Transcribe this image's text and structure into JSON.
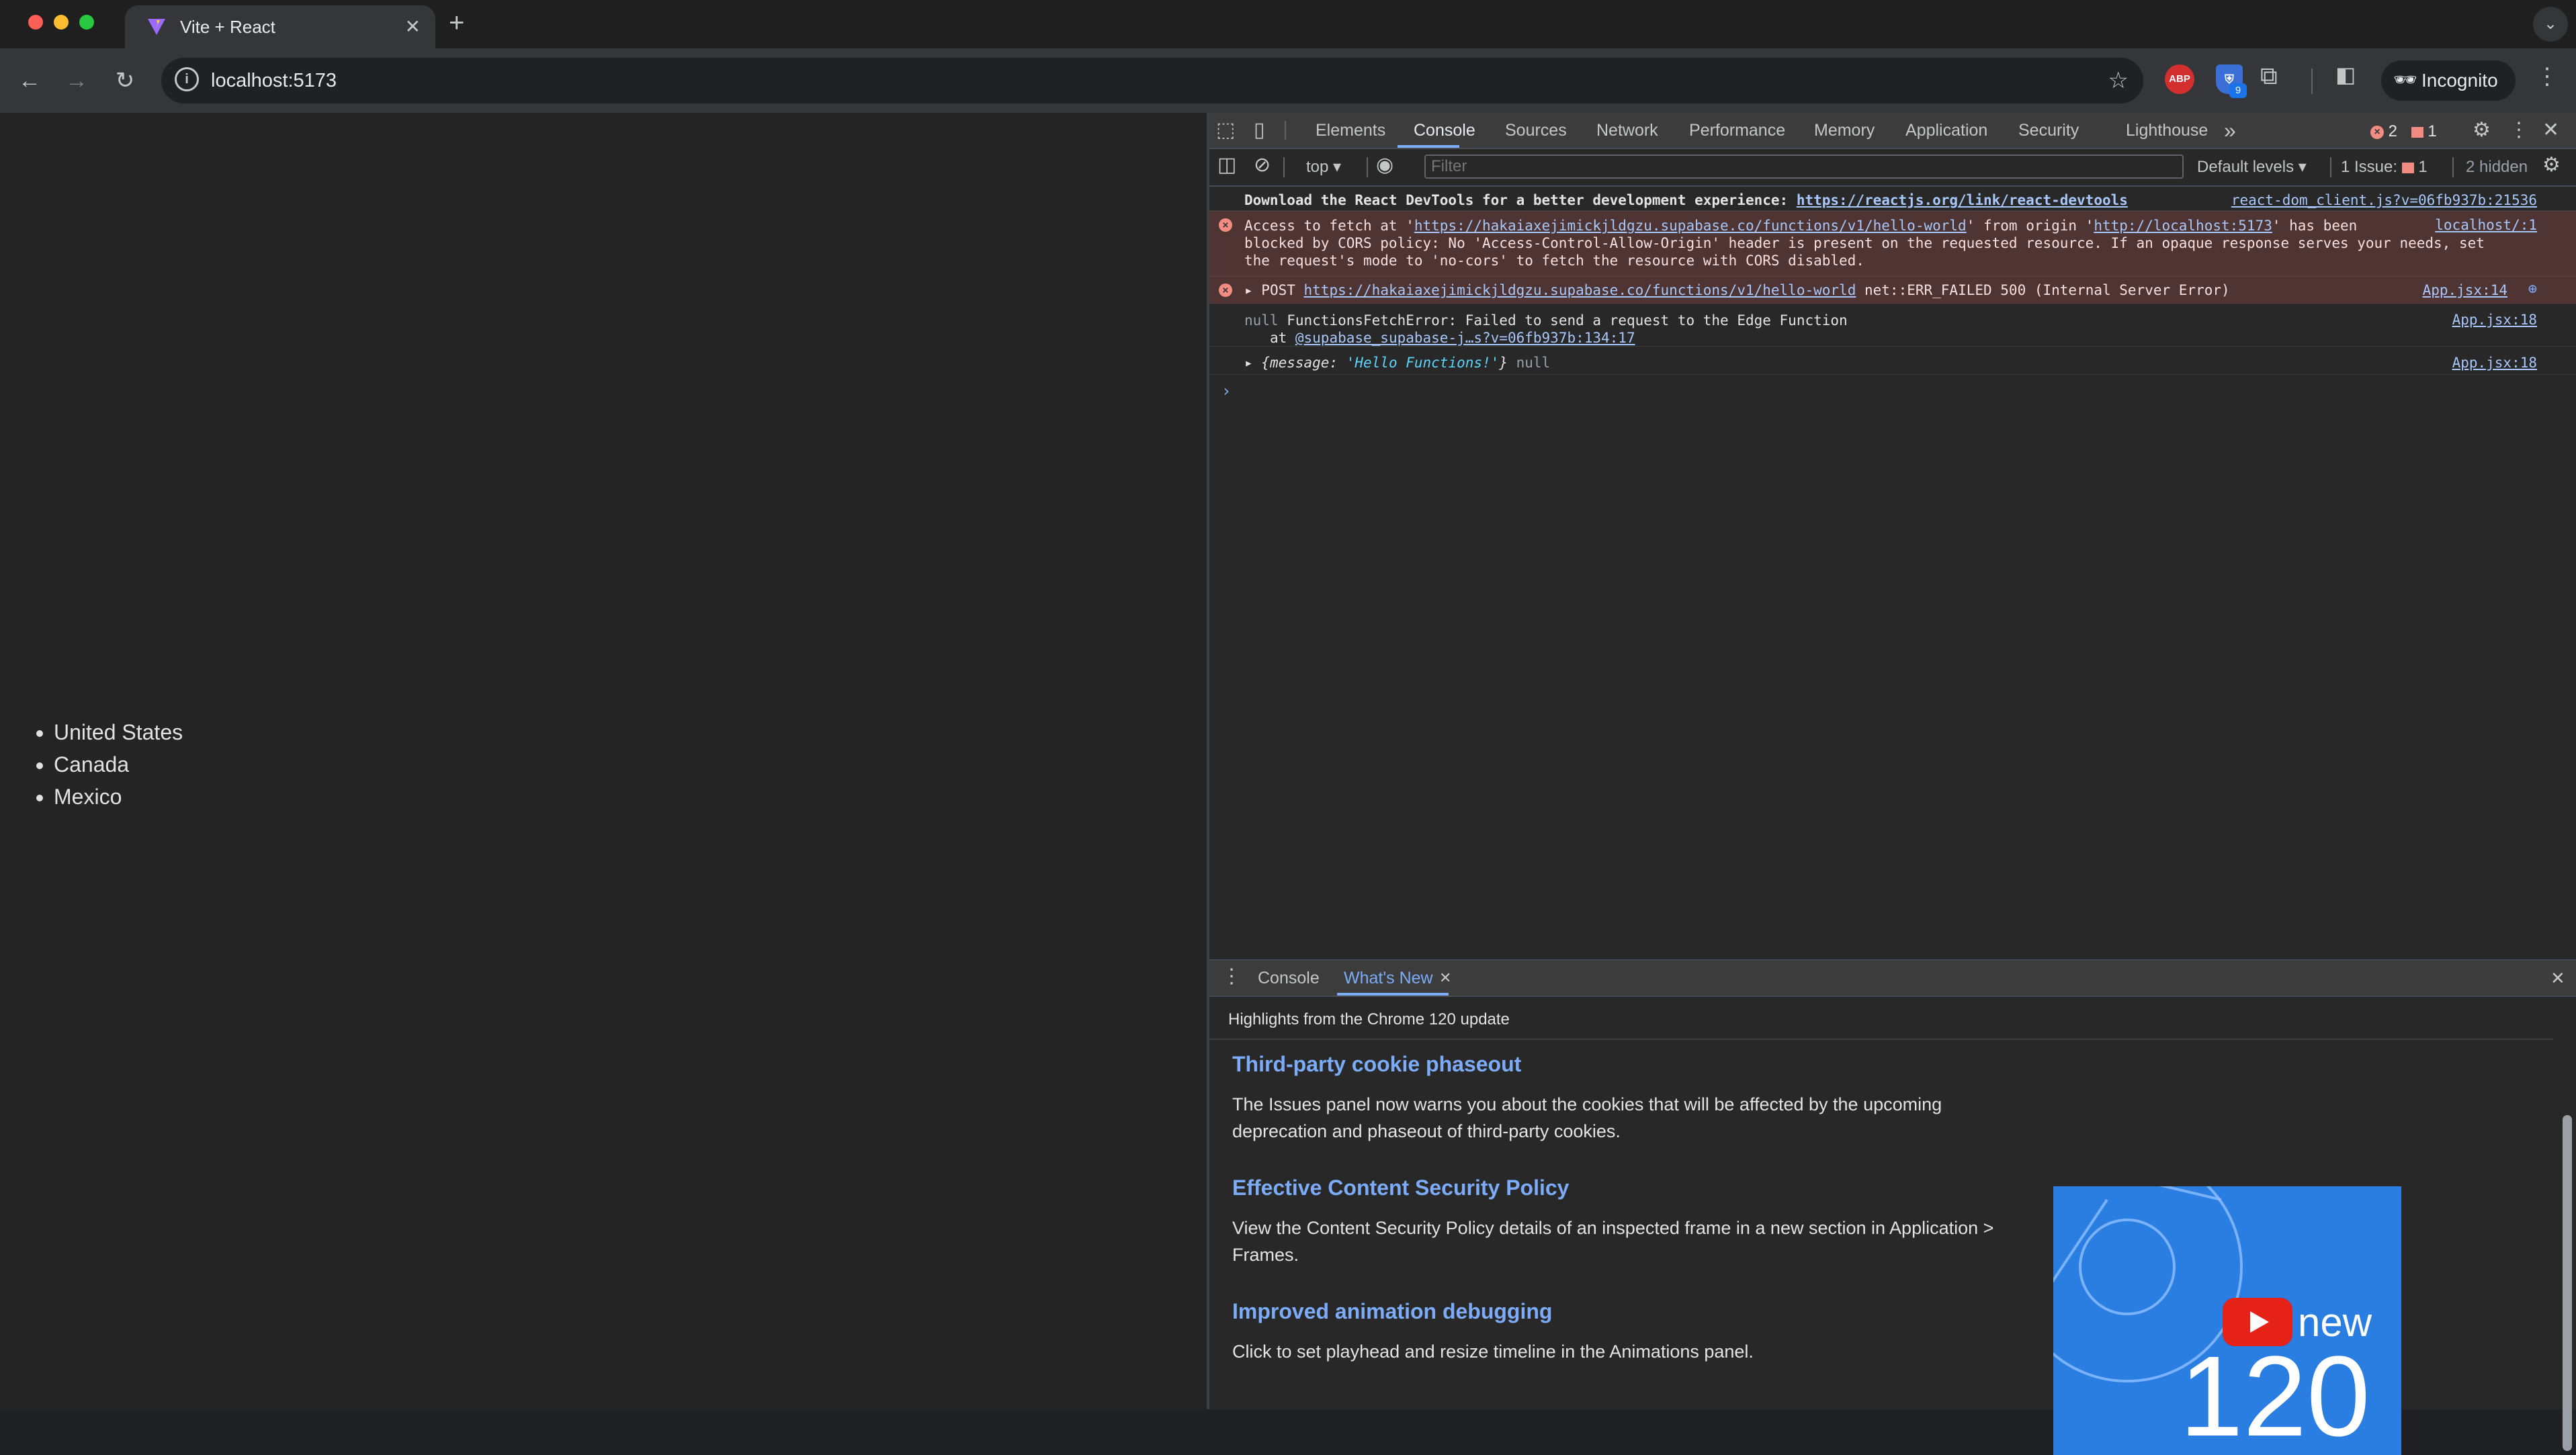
{
  "browser": {
    "tab": {
      "title": "Vite + React",
      "close": "✕"
    },
    "new_tab": "+",
    "tab_search": "⌄",
    "url": "localhost:5173",
    "incognito_label": "Incognito",
    "extensions": {
      "adblock": "ABP",
      "bitwarden_badge": "9"
    }
  },
  "page": {
    "countries": [
      "United States",
      "Canada",
      "Mexico"
    ]
  },
  "devtools": {
    "tabs": [
      "Elements",
      "Console",
      "Sources",
      "Network",
      "Performance",
      "Memory",
      "Application",
      "Security",
      "Lighthouse"
    ],
    "more_tabs": "»",
    "error_count": "2",
    "issue_count": "1",
    "toolbar": {
      "context": "top",
      "filter_placeholder": "Filter",
      "levels": "Default levels",
      "issues_label": "1 Issue:",
      "issues_count": "1",
      "hidden": "2 hidden"
    },
    "messages": {
      "info": {
        "text": "Download the React DevTools for a better development experience: ",
        "link": "https://reactjs.org/link/react-devtools",
        "source": "react-dom_client.js?v=06fb937b:21536"
      },
      "cors": {
        "prefix": "Access to fetch at '",
        "url": "https://hakaiaxejimickjldgzu.supabase.co/functions/v1/hello-world",
        "mid": "' from origin '",
        "origin": "http://localhost:5173",
        "rest1": "' has been",
        "rest2": "blocked by CORS policy: No 'Access-Control-Allow-Origin' header is present on the requested resource. If an opaque response serves your needs, set",
        "rest3": "the request's mode to 'no-cors' to fetch the resource with CORS disabled.",
        "source": "localhost/:1"
      },
      "post": {
        "method": "POST",
        "url": "https://hakaiaxejimickjldgzu.supabase.co/functions/v1/hello-world",
        "status": "net::ERR_FAILED 500 (Internal Server Error)",
        "source": "App.jsx:14"
      },
      "fetch_error": {
        "null": "null",
        "text": "FunctionsFetchError: Failed to send a request to the Edge Function",
        "at": "at ",
        "link": "@supabase_supabase-j…s?v=06fb937b:134:17",
        "source": "App.jsx:18"
      },
      "object": {
        "open": "{message: ",
        "value": "'Hello Functions!'",
        "close": "}",
        "null": "null",
        "source": "App.jsx:18"
      }
    },
    "drawer": {
      "tabs": [
        "Console",
        "What's New"
      ],
      "header": "Highlights from the Chrome 120 update",
      "sections": [
        {
          "title": "Third-party cookie phaseout",
          "body": "The Issues panel now warns you about the cookies that will be affected by the upcoming deprecation and phaseout of third-party cookies."
        },
        {
          "title": "Effective Content Security Policy",
          "body": "View the Content Security Policy details of an inspected frame in a new section in Application > Frames."
        },
        {
          "title": "Improved animation debugging",
          "body": "Click to set playhead and resize timeline in the Animations panel."
        }
      ],
      "thumbnail": {
        "new": "new",
        "version": "120"
      }
    }
  }
}
